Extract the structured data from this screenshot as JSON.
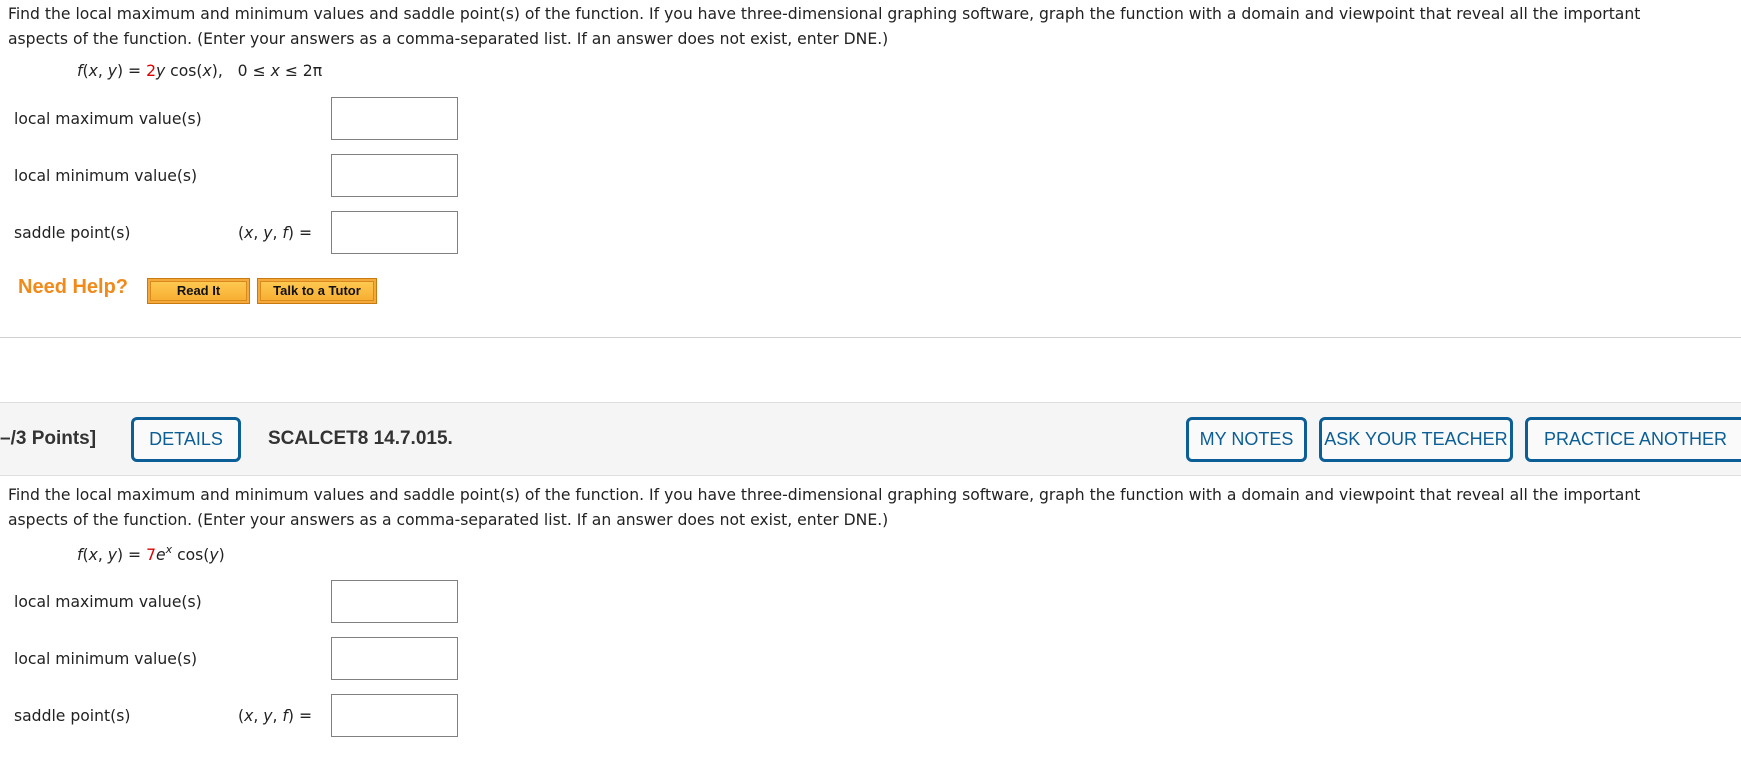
{
  "question1": {
    "instructions_line1": "Find the local maximum and minimum values and saddle point(s) of the function. If you have three-dimensional graphing software, graph the function with a domain and viewpoint that reveal all the important",
    "instructions_line2": "aspects of the function. (Enter your answers as a comma-separated list. If an answer does not exist, enter DNE.)",
    "formula": {
      "lhs": "f(x, y) = ",
      "coefficient": "2",
      "rest": "y cos(x),",
      "domain": "0 ≤ x ≤ 2π"
    },
    "fields": [
      {
        "label": "local maximum value(s)",
        "prefix": "",
        "value": ""
      },
      {
        "label": "local minimum value(s)",
        "prefix": "",
        "value": ""
      },
      {
        "label": "saddle point(s)",
        "prefix": "(x, y, f) =",
        "value": ""
      }
    ],
    "help": {
      "title": "Need Help?",
      "read_it": "Read It",
      "talk_to_tutor": "Talk to a Tutor"
    }
  },
  "question2": {
    "header": {
      "points": "–/3 Points]",
      "details_button": "DETAILS",
      "question_id": "SCALCET8 14.7.015.",
      "my_notes_button": "MY NOTES",
      "ask_teacher_button": "ASK YOUR TEACHER",
      "practice_another_button": "PRACTICE ANOTHER"
    },
    "instructions_line1": "Find the local maximum and minimum values and saddle point(s) of the function. If you have three-dimensional graphing software, graph the function with a domain and viewpoint that reveal all the important",
    "instructions_line2": "aspects of the function. (Enter your answers as a comma-separated list. If an answer does not exist, enter DNE.)",
    "formula": {
      "lhs": "f(x, y) = ",
      "coefficient": "7",
      "base": "e",
      "exponent": "x",
      "rest": " cos(y)"
    },
    "fields": [
      {
        "label": "local maximum value(s)",
        "prefix": "",
        "value": ""
      },
      {
        "label": "local minimum value(s)",
        "prefix": "",
        "value": ""
      },
      {
        "label": "saddle point(s)",
        "prefix": "(x, y, f) =",
        "value": ""
      }
    ]
  },
  "colors": {
    "coefficient_red": "#dd0000",
    "help_orange": "#f28a1a",
    "button_blue": "#0b5e96",
    "header_bg": "#f5f5f5"
  }
}
